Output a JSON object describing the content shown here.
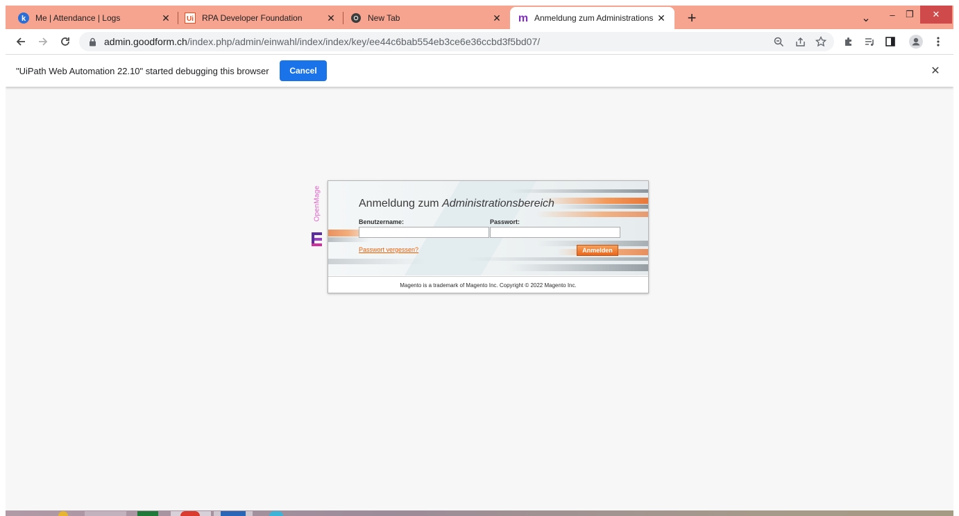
{
  "tabs": [
    {
      "title": "Me | Attendance | Logs",
      "icon": "k-avatar-icon",
      "close": "✕"
    },
    {
      "title": "RPA Developer Foundation",
      "icon": "uipath-ui-icon",
      "close": "✕"
    },
    {
      "title": "New Tab",
      "icon": "chrome-icon",
      "close": "✕"
    },
    {
      "title": "Anmeldung zum Administrations",
      "icon": "magento-m-icon",
      "close": "✕",
      "active": true
    }
  ],
  "new_tab_symbol": "+",
  "window": {
    "dropdown": "⌄",
    "minimize": "–",
    "restore": "❐",
    "close": "✕"
  },
  "address_bar": {
    "host": "admin.goodform.ch",
    "path": "/index.php/admin/einwahl/index/index/key/ee44c6bab554eb3ce6e36ccbd3f5bd07/"
  },
  "infobar": {
    "message": "\"UiPath Web Automation 22.10\" started debugging this browser",
    "cancel_label": "Cancel",
    "close": "✕"
  },
  "login": {
    "brand": "OpenMage",
    "heading_plain": "Anmeldung zum ",
    "heading_italic": "Administrationsbereich",
    "username_label": "Benutzername:",
    "username_value": "",
    "password_label": "Passwort:",
    "password_value": "",
    "forgot_link": "Passwort vergessen?",
    "submit_label": "Anmelden",
    "footer": "Magento is a trademark of Magento Inc. Copyright © 2022 Magento Inc."
  },
  "colors": {
    "tabstrip": "#f6a38f",
    "accent_blue": "#1a73e8",
    "magento_orange": "#eb5e00",
    "openmage_pink": "#e060c8"
  }
}
